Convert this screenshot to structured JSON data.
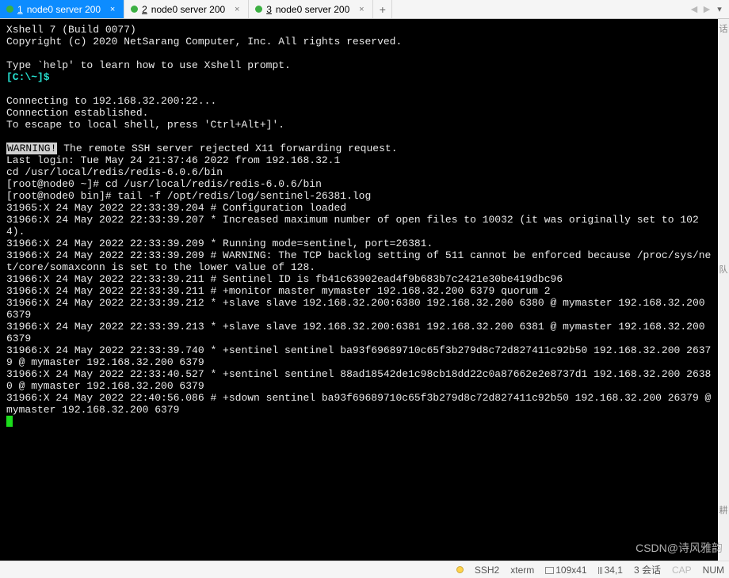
{
  "tabs": [
    {
      "num": "1",
      "label": "node0 server 200",
      "active": true
    },
    {
      "num": "2",
      "label": "node0 server 200",
      "active": false
    },
    {
      "num": "3",
      "label": "node0 server 200",
      "active": false
    }
  ],
  "terminal": {
    "header1": "Xshell 7 (Build 0077)",
    "header2": "Copyright (c) 2020 NetSarang Computer, Inc. All rights reserved.",
    "blank": "",
    "hint": "Type `help' to learn how to use Xshell prompt.",
    "prompt": "[C:\\~]$",
    "conn1": "Connecting to 192.168.32.200:22...",
    "conn2": "Connection established.",
    "conn3": "To escape to local shell, press 'Ctrl+Alt+]'.",
    "warn_label": "WARNING!",
    "warn_rest": " The remote SSH server rejected X11 forwarding request.",
    "last_login": "Last login: Tue May 24 21:37:46 2022 from 192.168.32.1",
    "cd_line": "cd /usr/local/redis/redis-6.0.6/bin",
    "root1": "[root@node0 ~]# cd /usr/local/redis/redis-6.0.6/bin",
    "root2": "[root@node0 bin]# tail -f /opt/redis/log/sentinel-26381.log",
    "log01": "31965:X 24 May 2022 22:33:39.204 # Configuration loaded",
    "log02": "31966:X 24 May 2022 22:33:39.207 * Increased maximum number of open files to 10032 (it was originally set to 1024).",
    "log03": "31966:X 24 May 2022 22:33:39.209 * Running mode=sentinel, port=26381.",
    "log04": "31966:X 24 May 2022 22:33:39.209 # WARNING: The TCP backlog setting of 511 cannot be enforced because /proc/sys/net/core/somaxconn is set to the lower value of 128.",
    "log05": "31966:X 24 May 2022 22:33:39.211 # Sentinel ID is fb41c63902ead4f9b683b7c2421e30be419dbc96",
    "log06": "31966:X 24 May 2022 22:33:39.211 # +monitor master mymaster 192.168.32.200 6379 quorum 2",
    "log07": "31966:X 24 May 2022 22:33:39.212 * +slave slave 192.168.32.200:6380 192.168.32.200 6380 @ mymaster 192.168.32.200 6379",
    "log08": "31966:X 24 May 2022 22:33:39.213 * +slave slave 192.168.32.200:6381 192.168.32.200 6381 @ mymaster 192.168.32.200 6379",
    "log09": "31966:X 24 May 2022 22:33:39.740 * +sentinel sentinel ba93f69689710c65f3b279d8c72d827411c92b50 192.168.32.200 26379 @ mymaster 192.168.32.200 6379",
    "log10": "31966:X 24 May 2022 22:33:40.527 * +sentinel sentinel 88ad18542de1c98cb18dd22c0a87662e2e8737d1 192.168.32.200 26380 @ mymaster 192.168.32.200 6379",
    "log11": "31966:X 24 May 2022 22:40:56.086 # +sdown sentinel ba93f69689710c65f3b279d8c72d827411c92b50 192.168.32.200 26379 @ mymaster 192.168.32.200 6379"
  },
  "status": {
    "proto": "SSH2",
    "term": "xterm",
    "size": "109x41",
    "cursor": "34,1",
    "sess": "3 会话",
    "cap": "CAP",
    "num": "NUM"
  },
  "gutter": {
    "g1": "话",
    "g2": "队",
    "g3": "耕"
  },
  "watermark": "CSDN@诗风雅韵"
}
